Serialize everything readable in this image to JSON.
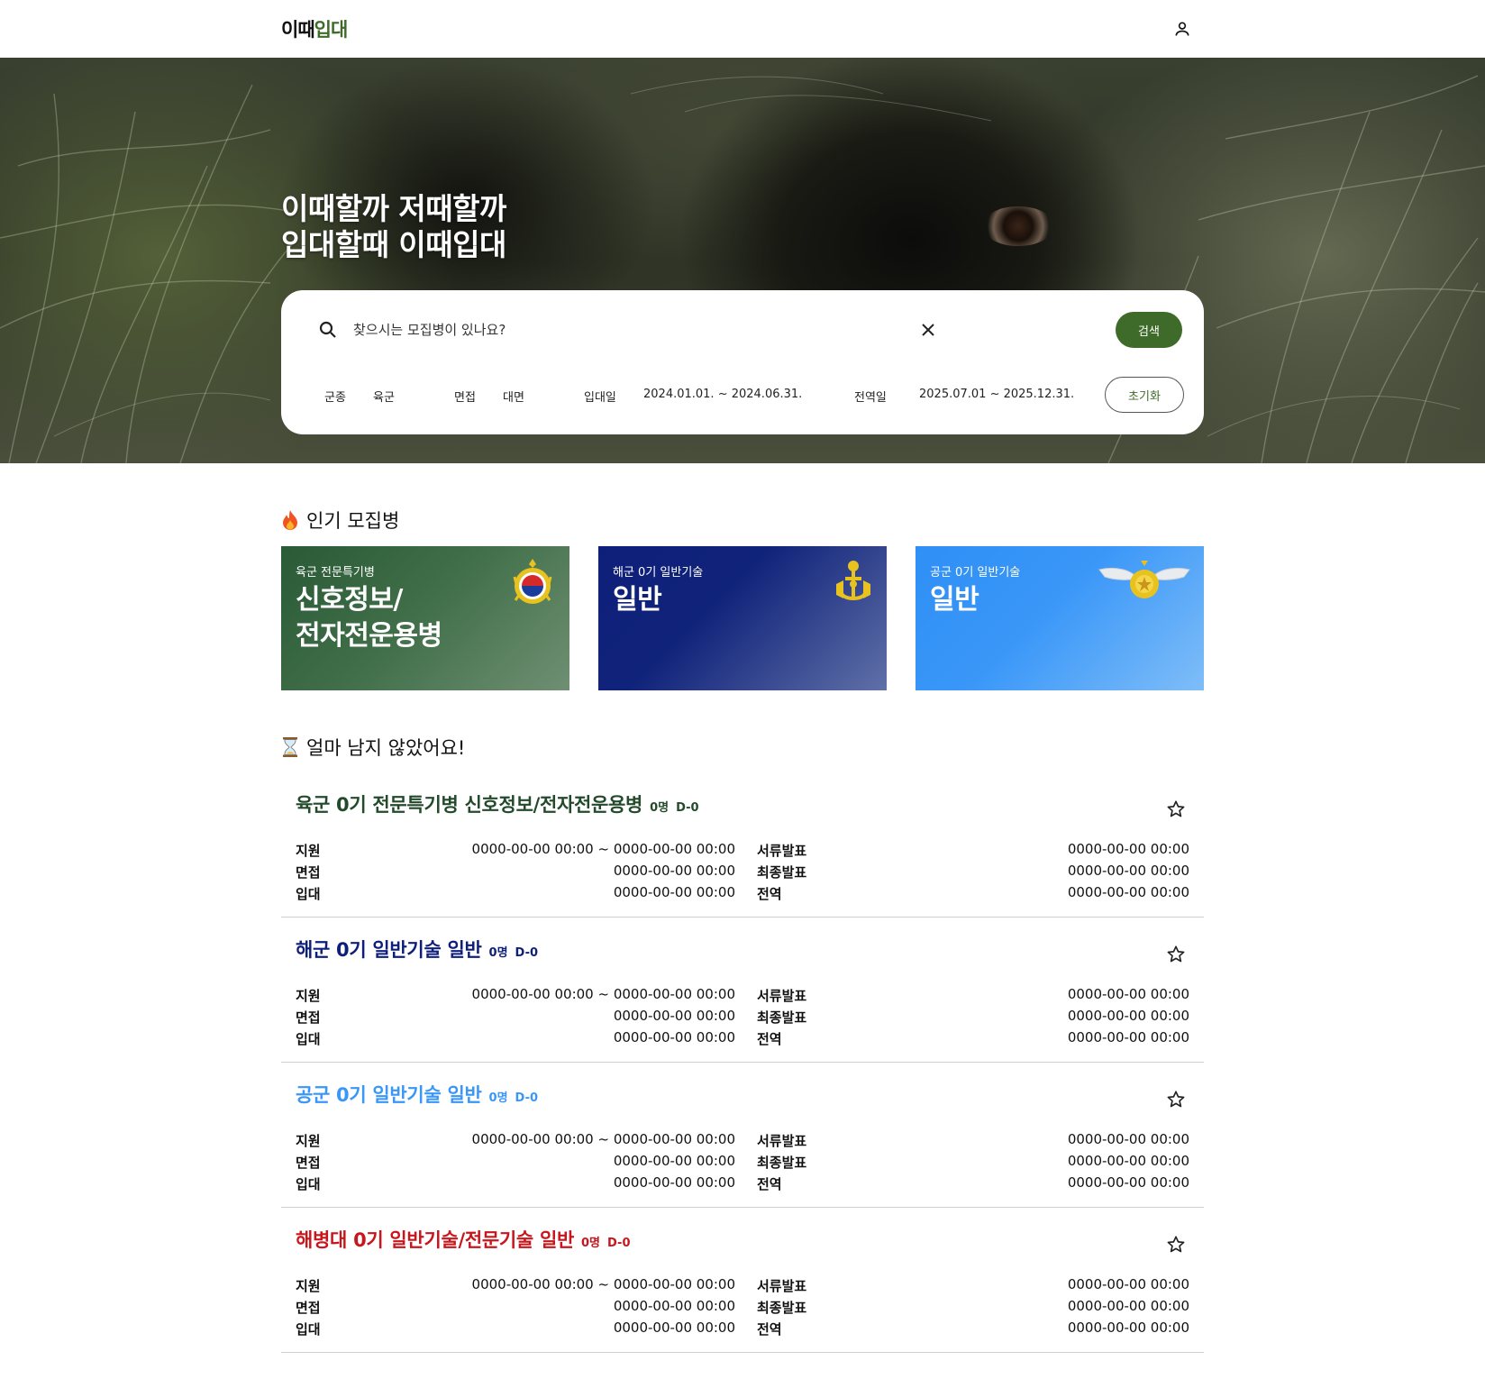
{
  "header": {
    "logo_part1": "이때",
    "logo_part2": "입대",
    "user_icon": "user-icon"
  },
  "hero": {
    "title_line1": "이때할까 저때할까",
    "title_line2": "입대할때 이때입대"
  },
  "search": {
    "placeholder": "찾으시는 모집병이 있나요?",
    "search_button": "검색",
    "reset_button": "초기화",
    "filters": {
      "branch_label": "군종",
      "branch_value": "육군",
      "interview_label": "면접",
      "interview_value": "대면",
      "enlist_label": "입대일",
      "enlist_value": "2024.01.01. ~ 2024.06.31.",
      "discharge_label": "전역일",
      "discharge_value": "2025.07.01 ~ 2025.12.31."
    }
  },
  "popular": {
    "title": "인기 모집병",
    "emoji": "fire-icon",
    "cards": [
      {
        "sub": "육군 전문특기병",
        "main_line1": "신호정보/",
        "main_line2": "전자전운용병",
        "emblem": "army-emblem-icon"
      },
      {
        "sub": "해군 0기 일반기술",
        "main_line1": "일반",
        "main_line2": "",
        "emblem": "navy-emblem-icon"
      },
      {
        "sub": "공군 0기 일반기술",
        "main_line1": "일반",
        "main_line2": "",
        "emblem": "airforce-emblem-icon"
      }
    ]
  },
  "deadline": {
    "title": "얼마 남지 않았어요!",
    "emoji": "hourglass-icon",
    "labels": {
      "apply": "지원",
      "interview": "면접",
      "enlist": "입대",
      "doc_result": "서류발표",
      "final_result": "최종발표",
      "discharge": "전역"
    },
    "items": [
      {
        "title": "육군 0기 전문특기병 신호정보/전자전운용병",
        "count": "0명",
        "dday": "D-0",
        "color": "#234a2b",
        "apply": "0000-00-00 00:00 ~ 0000-00-00 00:00",
        "interview": "0000-00-00 00:00",
        "enlist": "0000-00-00 00:00",
        "doc_result": "0000-00-00 00:00",
        "final_result": "0000-00-00 00:00",
        "discharge": "0000-00-00 00:00"
      },
      {
        "title": "해군 0기 일반기술 일반",
        "count": "0명",
        "dday": "D-0",
        "color": "#0e1f7a",
        "apply": "0000-00-00 00:00 ~ 0000-00-00 00:00",
        "interview": "0000-00-00 00:00",
        "enlist": "0000-00-00 00:00",
        "doc_result": "0000-00-00 00:00",
        "final_result": "0000-00-00 00:00",
        "discharge": "0000-00-00 00:00"
      },
      {
        "title": "공군 0기 일반기술 일반",
        "count": "0명",
        "dday": "D-0",
        "color": "#3a97f8",
        "apply": "0000-00-00 00:00 ~ 0000-00-00 00:00",
        "interview": "0000-00-00 00:00",
        "enlist": "0000-00-00 00:00",
        "doc_result": "0000-00-00 00:00",
        "final_result": "0000-00-00 00:00",
        "discharge": "0000-00-00 00:00"
      },
      {
        "title": "해병대 0기 일반기술/전문기술 일반",
        "count": "0명",
        "dday": "D-0",
        "color": "#c8161d",
        "apply": "0000-00-00 00:00 ~ 0000-00-00 00:00",
        "interview": "0000-00-00 00:00",
        "enlist": "0000-00-00 00:00",
        "doc_result": "0000-00-00 00:00",
        "final_result": "0000-00-00 00:00",
        "discharge": "0000-00-00 00:00"
      }
    ]
  }
}
